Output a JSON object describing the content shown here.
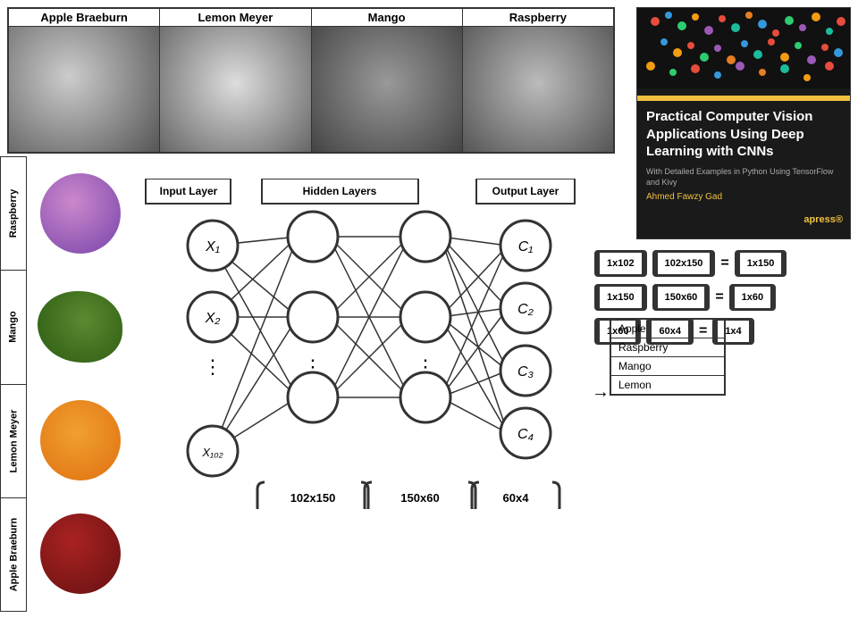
{
  "top_fruits": [
    {
      "label": "Apple Braeburn",
      "style": "apple-gray"
    },
    {
      "label": "Lemon Meyer",
      "style": "lemon-gray"
    },
    {
      "label": "Mango",
      "style": "mango-gray"
    },
    {
      "label": "Raspberry",
      "style": "raspberry-gray"
    }
  ],
  "book": {
    "title": "Practical Computer Vision Applications Using Deep Learning with CNNs",
    "subtitle": "With Detailed Examples in Python Using TensorFlow and Kivy",
    "author": "Ahmed Fawzy Gad",
    "publisher": "apress®"
  },
  "side_labels": [
    "Raspberry",
    "Mango",
    "Lemon Meyer",
    "Apple Braeburn"
  ],
  "layer_labels": {
    "input": "Input Layer",
    "hidden": "Hidden Layers",
    "output": "Output Layer"
  },
  "nn_nodes": {
    "input": [
      "X₁",
      "X₂",
      "⋮",
      "X₁₀₂"
    ],
    "output": [
      "C₁",
      "C₂",
      "C₃",
      "C₄"
    ]
  },
  "matrix_rows": [
    {
      "m1": "1x102",
      "m2": "102x150",
      "eq": "=",
      "m3": "1x150"
    },
    {
      "m1": "1x150",
      "m2": "150x60",
      "eq": "=",
      "m3": "1x60"
    },
    {
      "m1": "1x60",
      "m2": "60x4",
      "eq": "=",
      "m3": "1x4"
    }
  ],
  "bottom_matrices": [
    "102x150",
    "150x60",
    "60x4"
  ],
  "output_classes": [
    "Apple",
    "Raspberry",
    "Mango",
    "Lemon"
  ]
}
